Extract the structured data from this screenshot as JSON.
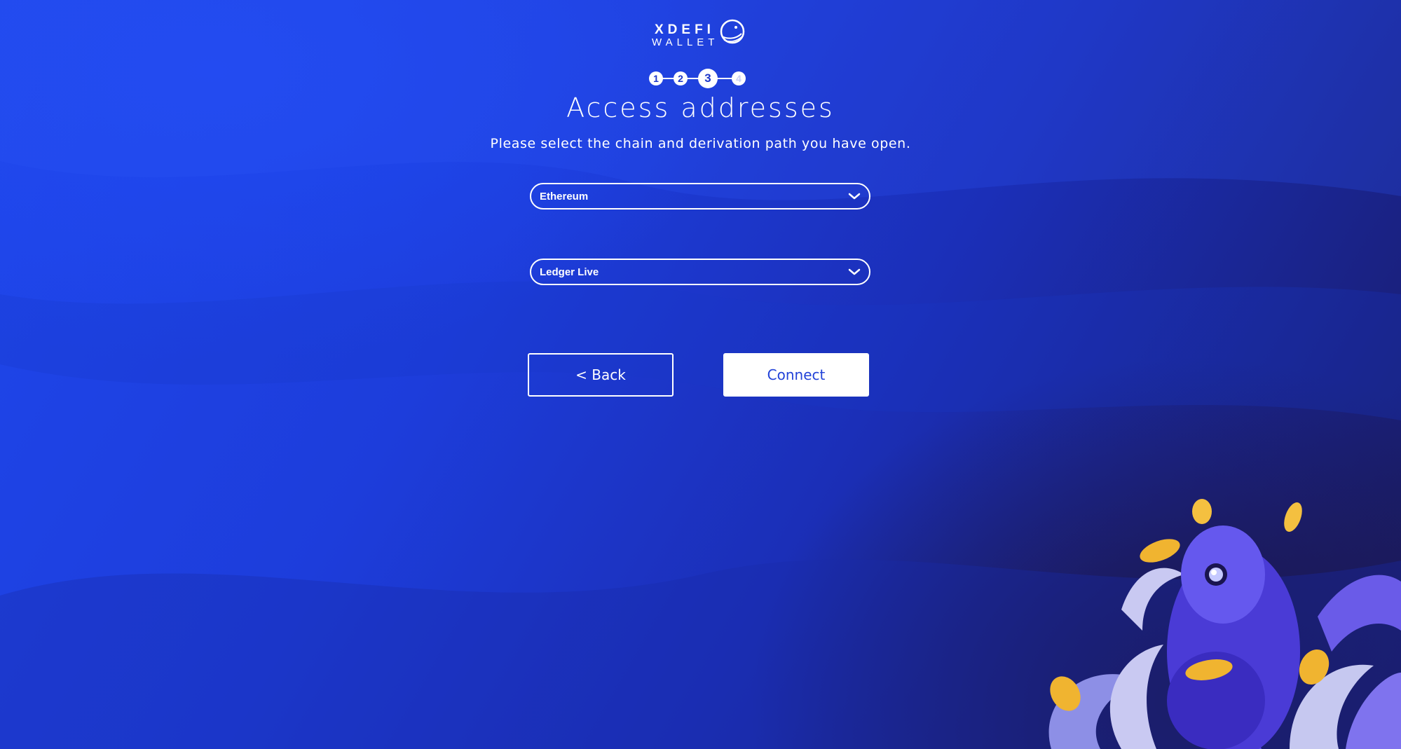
{
  "brand": {
    "logo_top": "XDEFI",
    "logo_bottom": "WALLET"
  },
  "stepper": {
    "steps": [
      "1",
      "2",
      "3",
      "4"
    ],
    "current_step": 3
  },
  "page": {
    "title": "Access addresses",
    "subtitle": "Please select the chain and derivation path you have open."
  },
  "form": {
    "chain_select": {
      "value": "Ethereum",
      "icon": "chevron-down-icon"
    },
    "derivation_select": {
      "value": "Ledger Live",
      "icon": "chevron-down-icon"
    }
  },
  "actions": {
    "back_label": "< Back",
    "connect_label": "Connect"
  },
  "colors": {
    "background_start": "#1f47ec",
    "background_end": "#1a1a5a",
    "accent": "#2142d8",
    "white": "#ffffff"
  }
}
